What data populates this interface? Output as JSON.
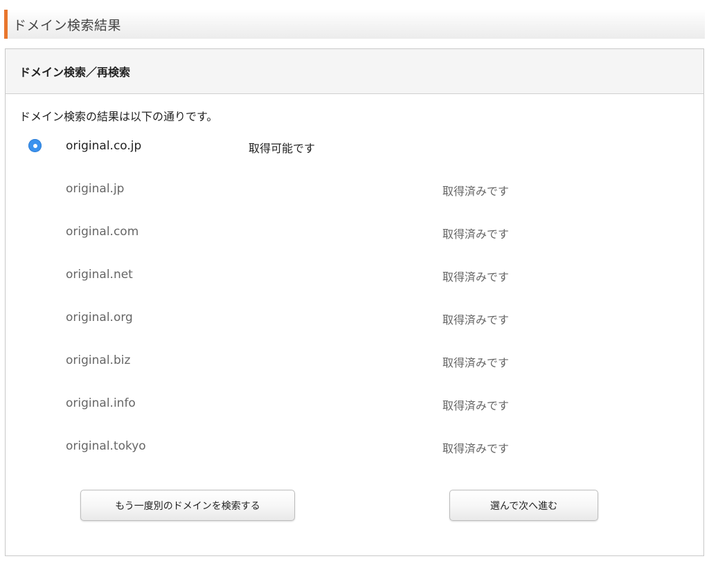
{
  "page": {
    "title": "ドメイン検索結果"
  },
  "panel": {
    "heading": "ドメイン検索／再検索",
    "intro": "ドメイン検索の結果は以下の通りです。"
  },
  "domains": [
    {
      "name": "original.co.jp",
      "status": "取得可能です",
      "available": true,
      "selected": true
    },
    {
      "name": "original.jp",
      "status": "取得済みです",
      "available": false
    },
    {
      "name": "original.com",
      "status": "取得済みです",
      "available": false
    },
    {
      "name": "original.net",
      "status": "取得済みです",
      "available": false
    },
    {
      "name": "original.org",
      "status": "取得済みです",
      "available": false
    },
    {
      "name": "original.biz",
      "status": "取得済みです",
      "available": false
    },
    {
      "name": "original.info",
      "status": "取得済みです",
      "available": false
    },
    {
      "name": "original.tokyo",
      "status": "取得済みです",
      "available": false
    }
  ],
  "buttons": {
    "research_label": "もう一度別のドメインを検索する",
    "next_label": "選んで次へ進む"
  },
  "colors": {
    "header_accent": "#e8762d",
    "radio_selected": "#3b92ee"
  }
}
